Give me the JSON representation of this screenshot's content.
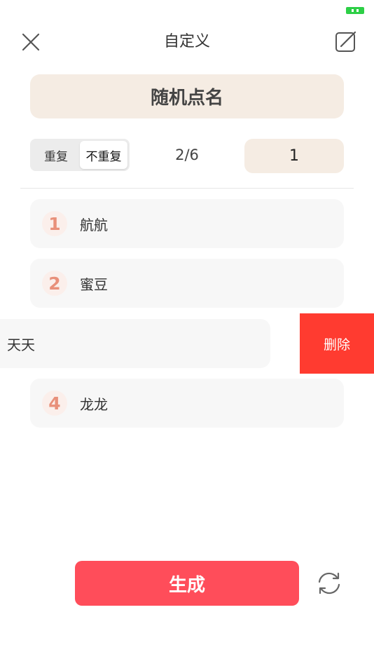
{
  "header": {
    "title": "自定义",
    "close_icon": "close-icon",
    "edit_icon": "edit-icon"
  },
  "status_bar": {
    "battery_icon": "battery-icon",
    "battery_color": "#2dcf46"
  },
  "mode": {
    "label": "随机点名"
  },
  "settings": {
    "repeat_label": "重复",
    "no_repeat_label": "不重复",
    "selected": "不重复",
    "progress": "2/6",
    "count_value": "1"
  },
  "list": {
    "items": [
      {
        "index": "1",
        "name": "航航"
      },
      {
        "index": "2",
        "name": "蜜豆"
      },
      {
        "index": "",
        "name": "天天"
      },
      {
        "index": "4",
        "name": "龙龙"
      }
    ],
    "delete_label": "删除"
  },
  "actions": {
    "generate_label": "生成",
    "refresh_icon": "refresh-icon"
  },
  "colors": {
    "accent": "#ff4d5a",
    "delete": "#ff3b30",
    "pill_bg": "#f5ece3",
    "index_text": "#e8907a"
  }
}
